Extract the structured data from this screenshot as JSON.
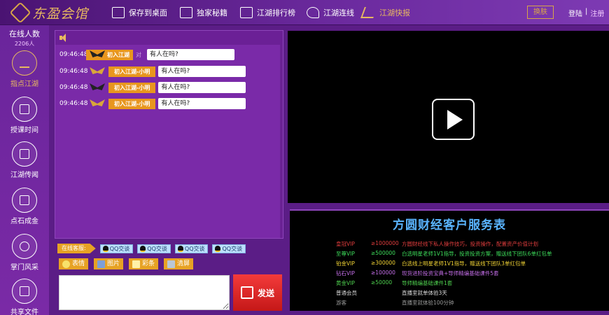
{
  "header": {
    "logo_text": "东盈会馆",
    "nav": [
      {
        "label": "保存到桌面",
        "icon": "monitor-icon"
      },
      {
        "label": "独家秘籍",
        "icon": "book-icon"
      },
      {
        "label": "江湖排行榜",
        "icon": "chart-icon"
      },
      {
        "label": "江湖连线",
        "icon": "phone-icon"
      },
      {
        "label": "江湖快报",
        "icon": "flash-icon",
        "active": true
      }
    ],
    "skin_label": "换肤",
    "login_label": "登陆",
    "auth_sep": "|",
    "register_label": "注册"
  },
  "sidebar": {
    "online_label": "在线人数",
    "online_count": "2206人",
    "items": [
      {
        "label": "指点江湖",
        "icon": "bar-chart-icon",
        "active": true
      },
      {
        "label": "授课时间",
        "icon": "presentation-icon"
      },
      {
        "label": "江湖传闻",
        "icon": "document-icon"
      },
      {
        "label": "点石成金",
        "icon": "book-icon"
      },
      {
        "label": "掌门风采",
        "icon": "user-icon"
      },
      {
        "label": "共享文件",
        "icon": "folder-icon"
      }
    ]
  },
  "chat": {
    "messages": [
      {
        "time": "09:46:48",
        "name": "初入江湖",
        "sep": "对",
        "text": "有人在吗?"
      },
      {
        "time": "09:46:48",
        "name": "初入江湖-小明",
        "text": "有人在吗?"
      },
      {
        "time": "09:46:48",
        "name": "初入江湖-小明",
        "text": "有人在吗?"
      },
      {
        "time": "09:46:48",
        "name": "初入江湖-小明",
        "text": "有人在吗?"
      }
    ],
    "service_label": "在线客服:",
    "qq_buttons": [
      "QQ交谈",
      "QQ交谈",
      "QQ交谈",
      "QQ交谈"
    ],
    "tools": [
      {
        "label": "表情",
        "icon": "smiley-icon"
      },
      {
        "label": "图片",
        "icon": "image-icon"
      },
      {
        "label": "彩条",
        "icon": "yen-icon"
      },
      {
        "label": "清屏",
        "icon": "broom-icon"
      }
    ],
    "send_label": "发送"
  },
  "service_table": {
    "title": "方圆财经客户服务表",
    "rows": [
      {
        "level": "皇冠VIP",
        "amount": "≥1000000",
        "desc": "方圆财经线下私人操作技巧，投资操作，配置资产价值计划"
      },
      {
        "level": "至尊VIP",
        "amount": "≥500000",
        "desc": "白选明星老师1V1指导，投资投资方案，赠送线下团队6单红包单"
      },
      {
        "level": "铂金VIP",
        "amount": "≥300000",
        "desc": "白选线上明星老师1V1指导，赠送线下团队3单红包单"
      },
      {
        "level": "钻石VIP",
        "amount": "≥100000",
        "desc": "现货进阶投资宝典+导师精编基础课件5套"
      },
      {
        "level": "黄金VIP",
        "amount": "≥50000",
        "desc": "导师精编基础课件1套"
      },
      {
        "level": "普通会员",
        "amount": "",
        "desc": "直播室就单体验3天"
      },
      {
        "level": "游客",
        "amount": "",
        "desc": "直播室就体验100分钟"
      }
    ],
    "colors": [
      "#e03d3d",
      "#3ddc5a",
      "#f0d234",
      "#c46ee8",
      "#4fd24f",
      "#dcdcdc",
      "#9a9a9a"
    ]
  }
}
